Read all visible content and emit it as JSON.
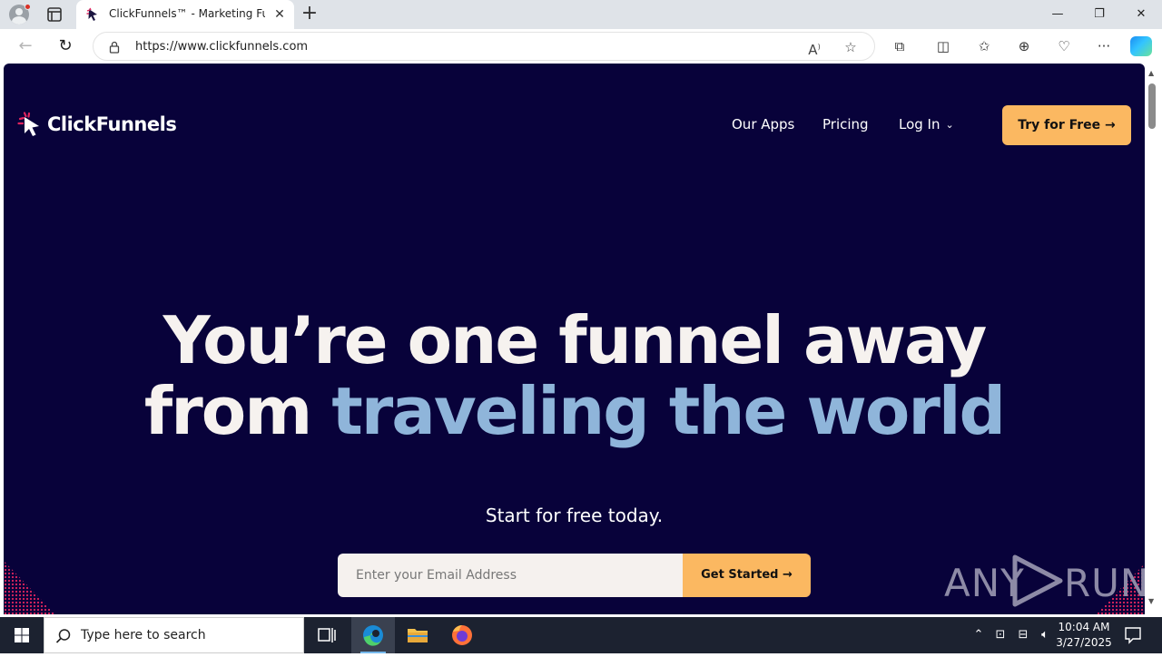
{
  "browser": {
    "tab_title": "ClickFunnels™ - Marketing Funnels",
    "tab_close": "✕",
    "new_tab": "+",
    "url_host": "https://www.clickfunnels.com",
    "window_controls": {
      "minimize": "—",
      "restore": "❐",
      "close": "✕"
    },
    "nav": {
      "back": "←",
      "refresh": "↻"
    },
    "toolbar_icons": [
      "read-aloud-icon",
      "favorite-star-icon",
      "extensions-icon",
      "split-screen-icon",
      "favorites-icon",
      "collections-icon",
      "browser-essentials-icon",
      "more-icon",
      "copilot-icon"
    ]
  },
  "site": {
    "logo_text": "ClickFunnels",
    "nav": {
      "our_apps": "Our Apps",
      "pricing": "Pricing",
      "login": "Log In",
      "cta": "Try for Free →"
    },
    "hero": {
      "line1": "You’re one funnel away",
      "line2_plain": "from",
      "line2_accent": "traveling the world"
    },
    "subhead": "Start for free today.",
    "signup": {
      "email_placeholder": "Enter your Email Address",
      "button": "Get Started →"
    },
    "colors": {
      "background": "#08023a",
      "accent_text": "#8fb5da",
      "cta": "#fbb861"
    }
  },
  "watermark": {
    "text_left": "ANY",
    "text_right": "RUN"
  },
  "taskbar": {
    "search_placeholder": "Type here to search",
    "clock_time": "10:04 AM",
    "clock_date": "3/27/2025"
  }
}
